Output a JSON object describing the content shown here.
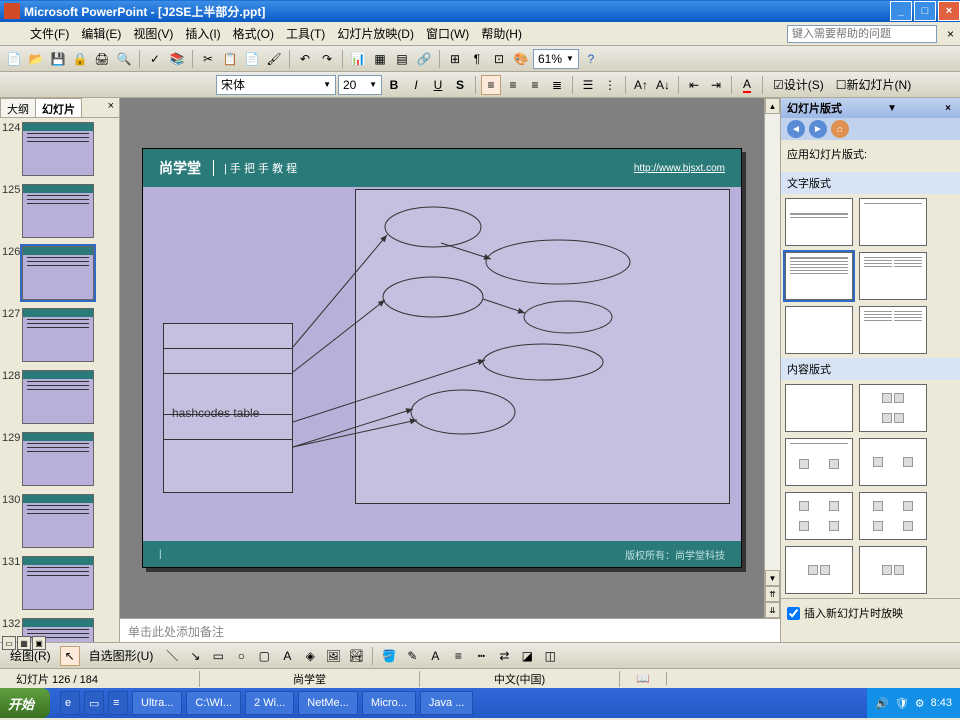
{
  "titlebar": {
    "text": "Microsoft PowerPoint - [J2SE上半部分.ppt]"
  },
  "menu": {
    "items": [
      "文件(F)",
      "编辑(E)",
      "视图(V)",
      "插入(I)",
      "格式(O)",
      "工具(T)",
      "幻灯片放映(D)",
      "窗口(W)",
      "帮助(H)"
    ],
    "help_placeholder": "键入需要帮助的问题"
  },
  "toolbar": {
    "zoom": "61%"
  },
  "fontbar": {
    "font": "宋体",
    "size": "20",
    "design": "设计(S)",
    "newslide": "新幻灯片(N)"
  },
  "outline": {
    "tab_outline": "大纲",
    "tab_slides": "幻灯片",
    "thumbs": [
      124,
      125,
      126,
      127,
      128,
      129,
      130,
      131,
      132
    ],
    "selected": 126
  },
  "slide": {
    "logo": "尚学堂",
    "subtitle": "| 手 把 手 教 程",
    "url": "http://www.bjsxt.com",
    "hash_label": "hashcodes table",
    "footer_copy": "版权所有：尚学堂科技"
  },
  "notes": {
    "placeholder": "单击此处添加备注"
  },
  "taskpane": {
    "title": "幻灯片版式",
    "apply_label": "应用幻灯片版式:",
    "text_layouts": "文字版式",
    "content_layouts": "内容版式",
    "insert_checkbox": "插入新幻灯片时放映"
  },
  "drawbar": {
    "draw": "绘图(R)",
    "autoshape": "自选图形(U)"
  },
  "status": {
    "slide": "幻灯片 126 / 184",
    "author": "尚学堂",
    "lang": "中文(中国)"
  },
  "taskbar": {
    "start": "开始",
    "items": [
      "Ultra...",
      "C:\\WI...",
      "2 Wi...",
      "NetMe...",
      "Micro...",
      "Java ..."
    ],
    "time": "8:43"
  }
}
